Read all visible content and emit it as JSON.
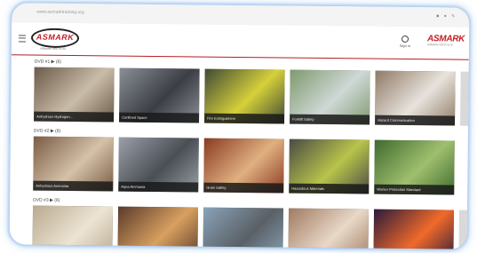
{
  "browser": {
    "url": "www.asmarktraining.org",
    "icons": "■ ● ✎"
  },
  "header": {
    "logo_text": "ASMARK",
    "logo_subtitle": "ASMARK INSTITUTE",
    "signin_label": "Sign in",
    "brand_text": "ASMARK",
    "brand_subtitle": "ASMARK INSTITUTE"
  },
  "sections": [
    {
      "label": "DVD #1 ▶ (6)",
      "items": [
        {
          "title": "Anhydrous Hydrogen...",
          "colors": [
            "#6b5b4a",
            "#c9bca8"
          ]
        },
        {
          "title": "Confined Space",
          "colors": [
            "#8a8f96",
            "#3b3e44"
          ]
        },
        {
          "title": "Fire Extinguishers",
          "colors": [
            "#3f4a35",
            "#d6d03a"
          ]
        },
        {
          "title": "Forklift Safety",
          "colors": [
            "#7e9a6d",
            "#cfd8d6"
          ]
        },
        {
          "title": "Hazard Communication",
          "colors": [
            "#8f7a66",
            "#e7e3dc"
          ]
        }
      ]
    },
    {
      "label": "DVD #2 ▶ (6)",
      "items": [
        {
          "title": "Anhydrous Ammonia",
          "colors": [
            "#7a5b44",
            "#d4c2a8"
          ]
        },
        {
          "title": "Aqua Ammonia",
          "colors": [
            "#9aa0a8",
            "#4a4e55"
          ]
        },
        {
          "title": "Grain Safety",
          "colors": [
            "#8a3a22",
            "#e0b080"
          ]
        },
        {
          "title": "Hazardous Materials",
          "colors": [
            "#4a4a45",
            "#b8c44a"
          ]
        },
        {
          "title": "Worker Protection Standard",
          "colors": [
            "#3f6a2e",
            "#9fbf6e"
          ]
        }
      ]
    },
    {
      "label": "DVD #3 ▶ (6)",
      "items": [
        {
          "title": "",
          "colors": [
            "#b9a98f",
            "#ece4d4"
          ]
        },
        {
          "title": "",
          "colors": [
            "#5a3a2a",
            "#d8a060"
          ]
        },
        {
          "title": "",
          "colors": [
            "#8aa3b8",
            "#5a6066"
          ]
        },
        {
          "title": "",
          "colors": [
            "#a07a60",
            "#e8d8c8"
          ]
        },
        {
          "title": "",
          "colors": [
            "#2a1a3a",
            "#f06a2a"
          ]
        }
      ]
    }
  ],
  "next_arrow": "›"
}
